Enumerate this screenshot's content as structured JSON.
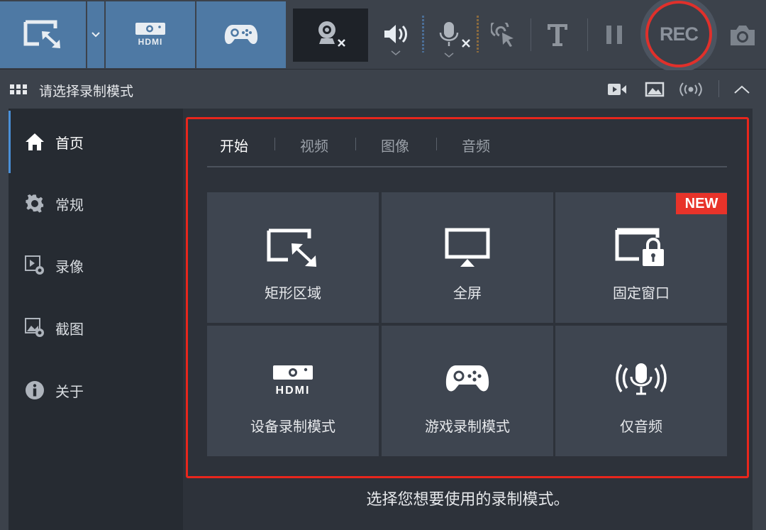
{
  "toolbar": {
    "modes": [
      {
        "name": "rectangle-mode",
        "icon": "rectangle-select-icon"
      },
      {
        "name": "mode-dropdown",
        "icon": "chevron-down-icon"
      },
      {
        "name": "device-mode",
        "icon": "hdmi-icon"
      },
      {
        "name": "game-mode",
        "icon": "gamepad-icon"
      }
    ],
    "hdmi_label": "HDMI",
    "rec_label": "REC",
    "accent": "#4e79a4",
    "rec_color": "#e0302b"
  },
  "titlebar": {
    "title": "请选择录制模式"
  },
  "sidebar": {
    "items": [
      {
        "label": "首页",
        "icon": "home-icon",
        "active": true
      },
      {
        "label": "常规",
        "icon": "gear-icon",
        "active": false
      },
      {
        "label": "录像",
        "icon": "video-settings-icon",
        "active": false
      },
      {
        "label": "截图",
        "icon": "image-settings-icon",
        "active": false
      },
      {
        "label": "关于",
        "icon": "info-icon",
        "active": false
      }
    ]
  },
  "tabs": [
    {
      "label": "开始",
      "active": true
    },
    {
      "label": "视频",
      "active": false
    },
    {
      "label": "图像",
      "active": false
    },
    {
      "label": "音频",
      "active": false
    }
  ],
  "tiles": [
    {
      "label": "矩形区域",
      "icon": "rectangle-select-icon"
    },
    {
      "label": "全屏",
      "icon": "monitor-icon"
    },
    {
      "label": "固定窗口",
      "icon": "locked-window-icon",
      "badge": "NEW"
    },
    {
      "label": "设备录制模式",
      "icon": "hdmi-icon",
      "icon_text": "HDMI"
    },
    {
      "label": "游戏录制模式",
      "icon": "gamepad-icon"
    },
    {
      "label": "仅音频",
      "icon": "microphone-waves-icon"
    }
  ],
  "hint": "选择您想要使用的录制模式。"
}
